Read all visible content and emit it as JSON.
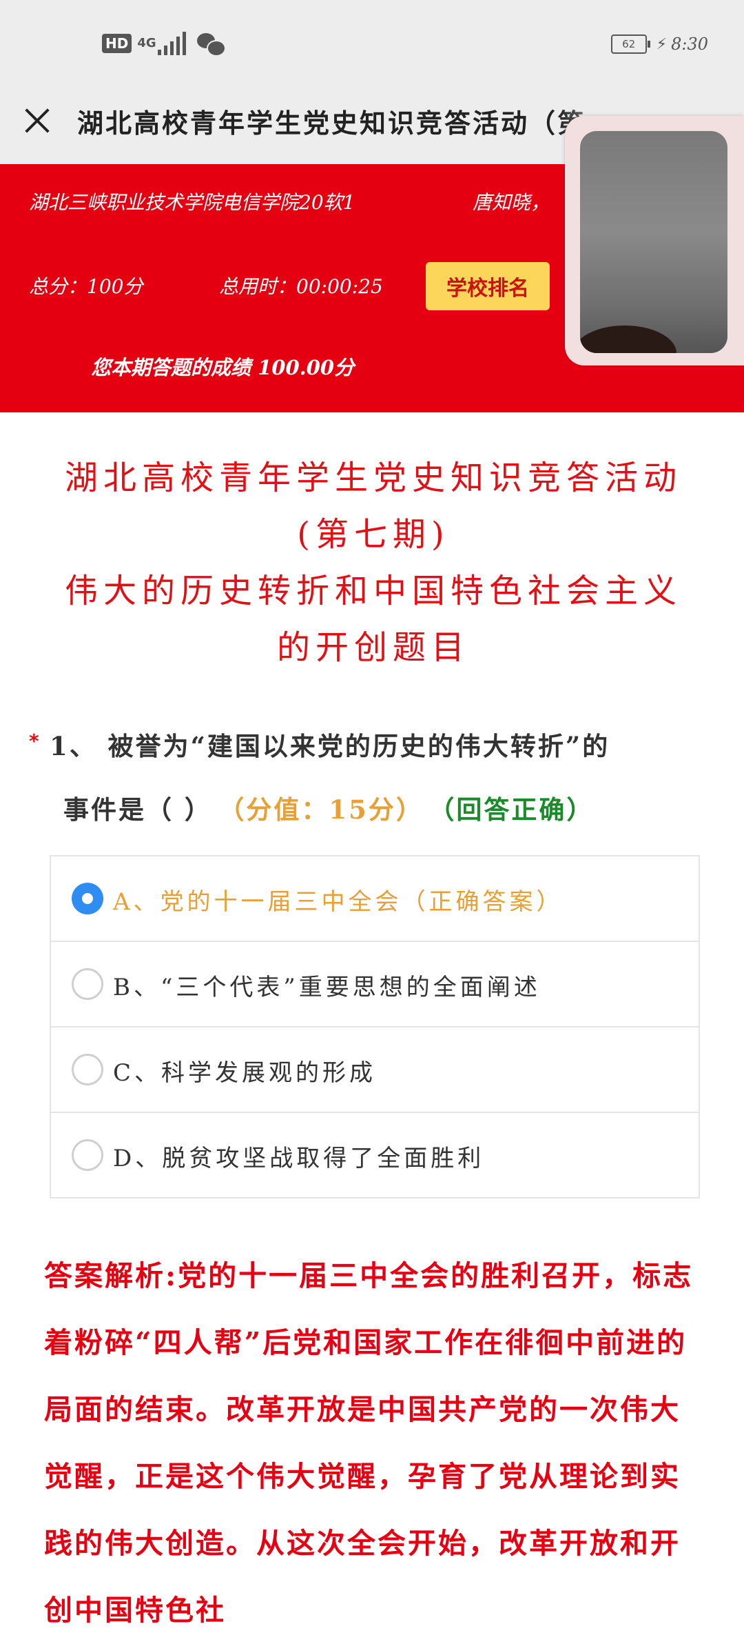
{
  "status_bar": {
    "hd": "HD",
    "network": "4G",
    "battery": "62",
    "time": "8:30"
  },
  "nav": {
    "title": "湖北高校青年学生党史知识竞答活动（第…"
  },
  "header": {
    "school": "湖北三峡职业技术学院电信学院20软1",
    "name": "唐知晓，",
    "total_score": "总分：100分",
    "total_time": "总用时：00:00:25",
    "rank_button": "学校排名",
    "result": "您本期答题的成绩  100.00分"
  },
  "content": {
    "title_line1": "湖北高校青年学生党史知识竞答活动",
    "title_line2": "(第七期)",
    "title_line3": "伟大的历史转折和中国特色社会主义",
    "title_line4": "的开创题目"
  },
  "question": {
    "required_mark": "*",
    "text_line1": "1、 被誉为“建国以来党的历史的伟大转折”的",
    "text_line2": "事件是（ ）",
    "score": "（分值：15分）",
    "status": "（回答正确）",
    "options": [
      {
        "letter": "A、",
        "text": "党的十一届三中全会",
        "flag": "（正确答案）"
      },
      {
        "letter": "B、",
        "text": "“三个代表”重要思想的全面阐述"
      },
      {
        "letter": "C、",
        "text": "科学发展观的形成"
      },
      {
        "letter": "D、",
        "text": "脱贫攻坚战取得了全面胜利"
      }
    ]
  },
  "analysis": {
    "text": "答案解析:党的十一届三中全会的胜利召开，标志着粉碎“四人帮”后党和国家工作在徘徊中前进的局面的结束。改革开放是中国共产党的一次伟大觉醒，正是这个伟大觉醒，孕育了党从理论到实践的伟大创造。从这次全会开始，改革开放和开创中国特色社"
  },
  "colors": {
    "header_red": "#e50011",
    "title_red": "#e20f14",
    "rank_yellow": "#fcd65a",
    "correct_orange": "#e8a035",
    "correct_green": "#1a8a2a",
    "radio_blue": "#2f8cf3"
  }
}
